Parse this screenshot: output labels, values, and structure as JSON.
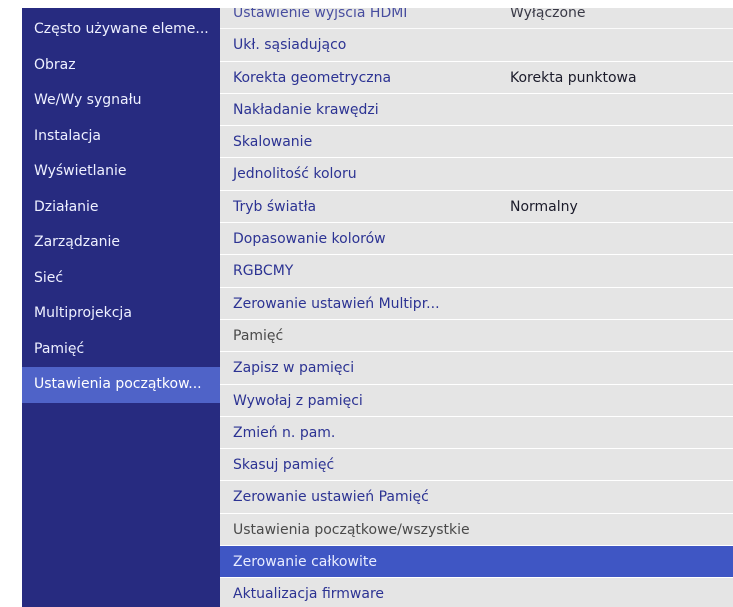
{
  "sidebar": {
    "items": [
      {
        "label": "Często używane eleme..."
      },
      {
        "label": "Obraz"
      },
      {
        "label": "We/Wy sygnału"
      },
      {
        "label": "Instalacja"
      },
      {
        "label": "Wyświetlanie"
      },
      {
        "label": "Działanie"
      },
      {
        "label": "Zarządzanie"
      },
      {
        "label": "Sieć"
      },
      {
        "label": "Multiprojekcja"
      },
      {
        "label": "Pamięć"
      },
      {
        "label": "Ustawienia początkow..."
      }
    ],
    "selected_index": 10
  },
  "panel": {
    "rows": [
      {
        "label": "Ustawienie wyjścia HDMI",
        "value": "Wyłączone"
      },
      {
        "label": "Ukł. sąsiadująco",
        "value": ""
      },
      {
        "label": "Korekta geometryczna",
        "value": "Korekta punktowa"
      },
      {
        "label": "Nakładanie krawędzi",
        "value": ""
      },
      {
        "label": "Skalowanie",
        "value": ""
      },
      {
        "label": "Jednolitość koloru",
        "value": ""
      },
      {
        "label": "Tryb światła",
        "value": "Normalny"
      },
      {
        "label": "Dopasowanie kolorów",
        "value": ""
      },
      {
        "label": "RGBCMY",
        "value": ""
      },
      {
        "label": "Zerowanie ustawień Multipr...",
        "value": ""
      },
      {
        "label": "Pamięć",
        "value": "",
        "type": "header"
      },
      {
        "label": "Zapisz w pamięci",
        "value": ""
      },
      {
        "label": "Wywołaj z pamięci",
        "value": ""
      },
      {
        "label": "Zmień n. pam.",
        "value": ""
      },
      {
        "label": "Skasuj pamięć",
        "value": ""
      },
      {
        "label": "Zerowanie ustawień Pamięć",
        "value": ""
      },
      {
        "label": "Ustawienia początkowe/wszystkie",
        "value": "",
        "type": "header"
      },
      {
        "label": "Zerowanie całkowite",
        "value": "",
        "type": "highlight"
      },
      {
        "label": "Aktualizacja firmware",
        "value": ""
      }
    ]
  },
  "colors": {
    "sidebar_bg": "#272b80",
    "sidebar_selected": "#4f63c8",
    "panel_bg": "#e5e5e5",
    "menu_text": "#2c3393",
    "highlight": "#3f56c4"
  }
}
